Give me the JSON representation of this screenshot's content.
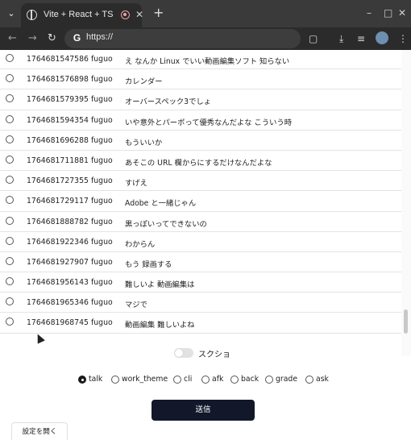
{
  "browser": {
    "tab_title": "Vite + React + TS",
    "url": "https://",
    "tab_icons": [
      "globe-icon",
      "recording-icon",
      "close-icon",
      "new-tab-icon"
    ],
    "toolbar_icons": [
      "back-icon",
      "forward-icon",
      "reload-icon",
      "extensions-icon",
      "download-icon",
      "playlist-icon",
      "profile-avatar",
      "kebab-menu-icon"
    ]
  },
  "messages": [
    {
      "timestamp": "1764681547586",
      "user": "fuguo",
      "text": "え なんか Linux でいい動画編集ソフト 知らない"
    },
    {
      "timestamp": "1764681576898",
      "user": "fuguo",
      "text": "カレンダー"
    },
    {
      "timestamp": "1764681579395",
      "user": "fuguo",
      "text": "オーバースペック3でしょ"
    },
    {
      "timestamp": "1764681594354",
      "user": "fuguo",
      "text": "いや意外とパーポって優秀なんだよな こういう時"
    },
    {
      "timestamp": "1764681696288",
      "user": "fuguo",
      "text": "もういいか"
    },
    {
      "timestamp": "1764681711881",
      "user": "fuguo",
      "text": "あそこの URL 欄からにするだけなんだよな"
    },
    {
      "timestamp": "1764681727355",
      "user": "fuguo",
      "text": "すげえ"
    },
    {
      "timestamp": "1764681729117",
      "user": "fuguo",
      "text": "Adobe と一緒じゃん"
    },
    {
      "timestamp": "1764681888782",
      "user": "fuguo",
      "text": "黒っぽいってできないの"
    },
    {
      "timestamp": "1764681922346",
      "user": "fuguo",
      "text": "わからん"
    },
    {
      "timestamp": "1764681927907",
      "user": "fuguo",
      "text": "もう 録画する"
    },
    {
      "timestamp": "1764681956143",
      "user": "fuguo",
      "text": "難しいよ 動画編集は"
    },
    {
      "timestamp": "1764681965346",
      "user": "fuguo",
      "text": "マジで"
    },
    {
      "timestamp": "1764681968745",
      "user": "fuguo",
      "text": "動画編集 難しいよね"
    }
  ],
  "screenshot_toggle": {
    "label": "スクショ",
    "on": false
  },
  "categories": {
    "selected": "talk",
    "options": [
      "talk",
      "work_theme",
      "cli",
      "afk",
      "back",
      "grade",
      "ask"
    ]
  },
  "send_label": "送信",
  "settings_label": "設定を開く",
  "colors": {
    "send_button": "#12182a",
    "chrome_tabbar": "#3a3a3a",
    "chrome_toolbar": "#2b2b2b"
  }
}
